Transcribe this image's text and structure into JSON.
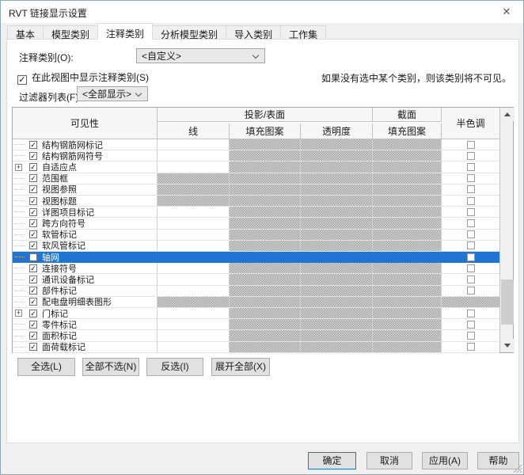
{
  "window": {
    "title": "RVT 链接显示设置",
    "close_glyph": "✕"
  },
  "tabs": [
    {
      "label": "基本",
      "active": false
    },
    {
      "label": "模型类别",
      "active": false
    },
    {
      "label": "注释类别",
      "active": true
    },
    {
      "label": "分析模型类别",
      "active": false
    },
    {
      "label": "导入类别",
      "active": false
    },
    {
      "label": "工作集",
      "active": false
    }
  ],
  "form": {
    "annotation_label": "注释类别(O):",
    "annotation_value": "<自定义>",
    "show_checkbox_label": "在此视图中显示注释类别(S)",
    "show_checkbox_checked": true,
    "note": "如果没有选中某个类别，则该类别将不可见。",
    "filter_label": "过滤器列表(F):",
    "filter_value": "<全部显示>"
  },
  "table": {
    "headers": {
      "visibility": "可见性",
      "projection_surface": "投影/表面",
      "cut": "截面",
      "halftone": "半色调",
      "lines": "线",
      "patterns": "填充图案",
      "transparency": "透明度",
      "cut_patterns": "填充图案"
    },
    "rows": [
      {
        "label": "结构钢筋网标记",
        "checked": true,
        "expander": false,
        "line_hatched": false,
        "selected": false,
        "full_hatched": false
      },
      {
        "label": "结构钢筋网符号",
        "checked": true,
        "expander": false,
        "line_hatched": false,
        "selected": false,
        "full_hatched": false
      },
      {
        "label": "自适应点",
        "checked": true,
        "expander": true,
        "line_hatched": false,
        "selected": false,
        "full_hatched": false
      },
      {
        "label": "范围框",
        "checked": true,
        "expander": false,
        "line_hatched": true,
        "selected": false,
        "full_hatched": false
      },
      {
        "label": "视图参照",
        "checked": true,
        "expander": false,
        "line_hatched": true,
        "selected": false,
        "full_hatched": false
      },
      {
        "label": "视图标题",
        "checked": true,
        "expander": false,
        "line_hatched": true,
        "selected": false,
        "full_hatched": false
      },
      {
        "label": "详图项目标记",
        "checked": true,
        "expander": false,
        "line_hatched": false,
        "selected": false,
        "full_hatched": false
      },
      {
        "label": "跨方向符号",
        "checked": true,
        "expander": false,
        "line_hatched": false,
        "selected": false,
        "full_hatched": false
      },
      {
        "label": "软管标记",
        "checked": true,
        "expander": false,
        "line_hatched": false,
        "selected": false,
        "full_hatched": false
      },
      {
        "label": "软风管标记",
        "checked": true,
        "expander": false,
        "line_hatched": false,
        "selected": false,
        "full_hatched": false
      },
      {
        "label": "轴网",
        "checked": false,
        "expander": false,
        "line_hatched": false,
        "selected": true,
        "full_hatched": false
      },
      {
        "label": "连接符号",
        "checked": true,
        "expander": false,
        "line_hatched": false,
        "selected": false,
        "full_hatched": false
      },
      {
        "label": "通讯设备标记",
        "checked": true,
        "expander": false,
        "line_hatched": false,
        "selected": false,
        "full_hatched": false
      },
      {
        "label": "部件标记",
        "checked": true,
        "expander": false,
        "line_hatched": false,
        "selected": false,
        "full_hatched": false
      },
      {
        "label": "配电盘明细表图形",
        "checked": true,
        "expander": false,
        "line_hatched": true,
        "selected": false,
        "full_hatched": true
      },
      {
        "label": "门标记",
        "checked": true,
        "expander": true,
        "line_hatched": false,
        "selected": false,
        "full_hatched": false
      },
      {
        "label": "零件标记",
        "checked": true,
        "expander": false,
        "line_hatched": false,
        "selected": false,
        "full_hatched": false
      },
      {
        "label": "面积标记",
        "checked": true,
        "expander": false,
        "line_hatched": false,
        "selected": false,
        "full_hatched": false
      },
      {
        "label": "面荷载标记",
        "checked": true,
        "expander": false,
        "line_hatched": false,
        "selected": false,
        "full_hatched": false
      }
    ]
  },
  "action_buttons": [
    {
      "label": "全选(L)"
    },
    {
      "label": "全部不选(N)"
    },
    {
      "label": "反选(I)"
    },
    {
      "label": "展开全部(X)"
    }
  ],
  "dialog_buttons": [
    {
      "label": "确定",
      "default": true
    },
    {
      "label": "取消",
      "default": false
    },
    {
      "label": "应用(A)",
      "default": false
    },
    {
      "label": "帮助",
      "default": false
    }
  ],
  "colors": {
    "selection_blue": "#1e76d2",
    "hatch_gray": "#b9b9b9",
    "dialog_bg": "#f0f0f0",
    "default_button_border": "#1e76d2"
  }
}
